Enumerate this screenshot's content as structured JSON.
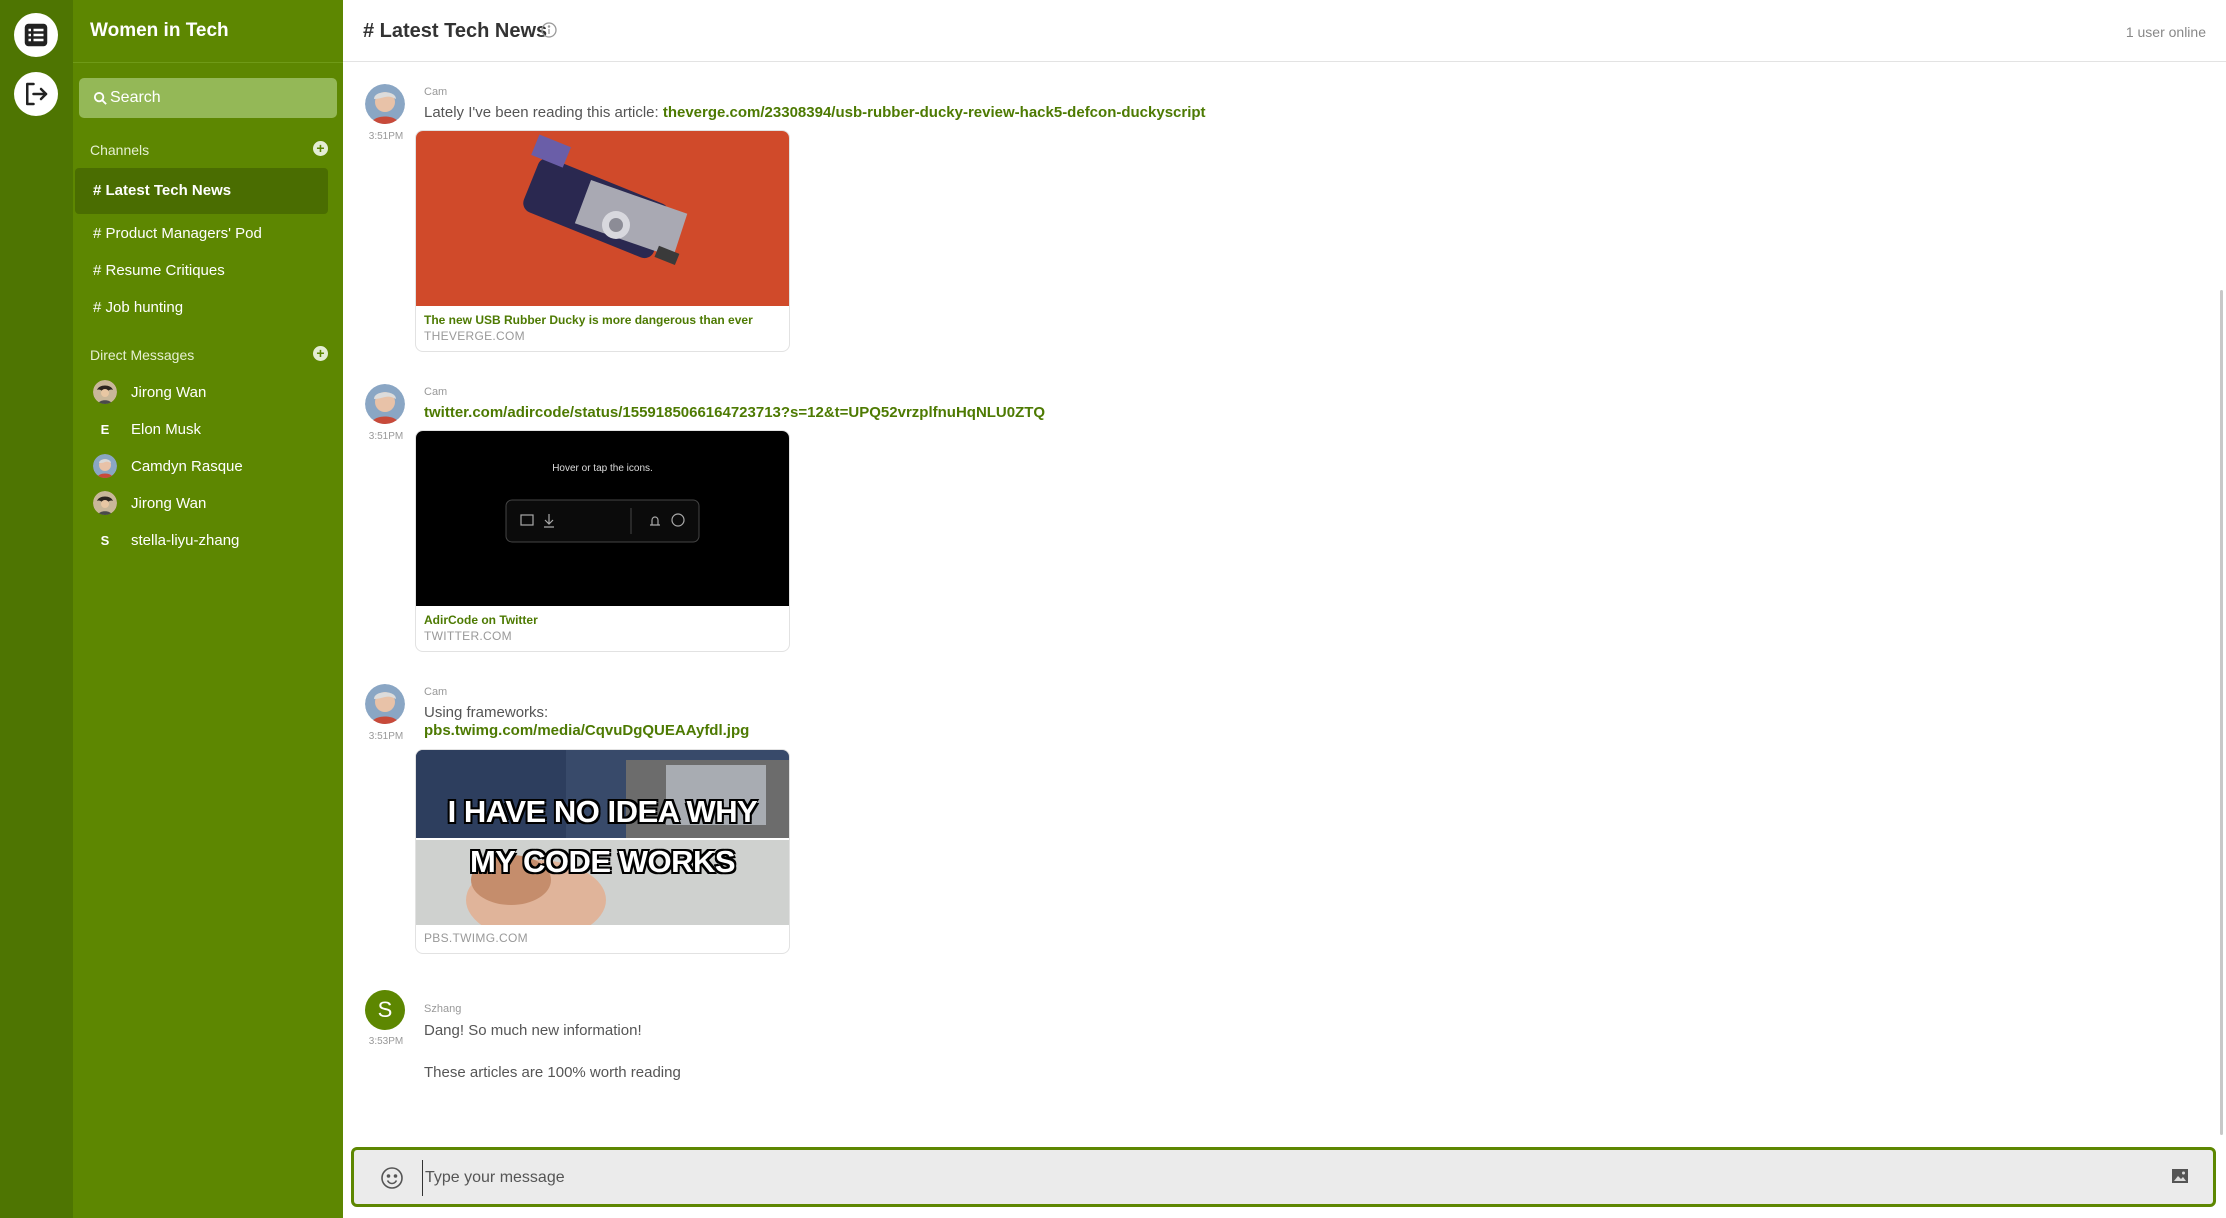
{
  "app": {
    "team_name": "Women in Tech"
  },
  "sidebar": {
    "search_label": "Search",
    "channels_title": "Channels",
    "dm_title": "Direct Messages",
    "channels": [
      {
        "label": "# Latest Tech News",
        "active": true
      },
      {
        "label": "# Product Managers' Pod"
      },
      {
        "label": "# Resume Critiques"
      },
      {
        "label": "# Job hunting"
      }
    ],
    "dms": [
      {
        "name": "Jirong Wan",
        "avatar": "photo"
      },
      {
        "name": "Elon Musk",
        "initial": "E"
      },
      {
        "name": "Camdyn Rasque",
        "avatar": "photo"
      },
      {
        "name": "Jirong Wan",
        "avatar": "photo"
      },
      {
        "name": "stella-liyu-zhang",
        "initial": "S"
      }
    ]
  },
  "header": {
    "title": "# Latest Tech News",
    "online": "1 user online"
  },
  "messages": [
    {
      "author": "Cam",
      "time": "3:51PM",
      "text": "Lately I've been reading this article: ",
      "link": "theverge.com/23308394/usb-rubber-ducky-review-hack5-defcon-duckyscript",
      "card": {
        "title": "The new USB Rubber Ducky is more dangerous than ever",
        "domain": "THEVERGE.COM"
      }
    },
    {
      "author": "Cam",
      "time": "3:51PM",
      "link": "twitter.com/adircode/status/1559185066164723713?s=12&t=UPQ52vrzplfnuHqNLU0ZTQ",
      "card": {
        "title": "AdirCode on Twitter",
        "domain": "TWITTER.COM",
        "image_text": "Hover or tap the icons."
      }
    },
    {
      "author": "Cam",
      "time": "3:51PM",
      "text": "Using frameworks:",
      "link": "pbs.twimg.com/media/CqvuDgQUEAAyfdl.jpg",
      "card": {
        "meme_top": "I HAVE NO IDEA WHY",
        "meme_bottom": "MY CODE WORKS",
        "domain": "PBS.TWIMG.COM"
      }
    },
    {
      "author": "Szhang",
      "time": "3:53PM",
      "initial": "S",
      "line1": "Dang! So much new information!",
      "line2": "These articles are 100% worth reading"
    }
  ],
  "composer": {
    "placeholder": "Type your message"
  },
  "colors": {
    "sidebar": "#5d8701",
    "rail": "#4e7502",
    "active_channel": "#4a6d01",
    "link": "#4d7a02"
  },
  "icons": [
    "list-icon",
    "logout-icon",
    "search-icon",
    "plus-icon",
    "info-icon",
    "emoji-icon",
    "image-icon"
  ]
}
